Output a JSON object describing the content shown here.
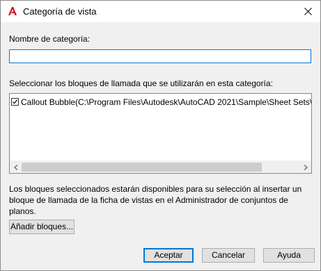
{
  "window": {
    "title": "Categoría de vista",
    "app_icon": "autocad-icon",
    "close_icon": "close-icon"
  },
  "form": {
    "name_label": "Nombre de categoría:",
    "name_value": "",
    "blocks_label": "Seleccionar los bloques de llamada que se utilizarán en esta categoría:",
    "blocks": [
      {
        "label": "Callout Bubble(C:\\Program Files\\Autodesk\\AutoCAD 2021\\Sample\\Sheet Sets\\Architectu",
        "checked": true
      }
    ],
    "description": "Los bloques seleccionados estarán disponibles para su selección al insertar un bloque de llamada de la ficha de vistas en el Administrador de conjuntos de planos."
  },
  "buttons": {
    "add_blocks": "Añadir bloques...",
    "ok": "Aceptar",
    "cancel": "Cancelar",
    "help": "Ayuda"
  },
  "colors": {
    "accent": "#0078d7",
    "autocad_red": "#d0021b"
  }
}
